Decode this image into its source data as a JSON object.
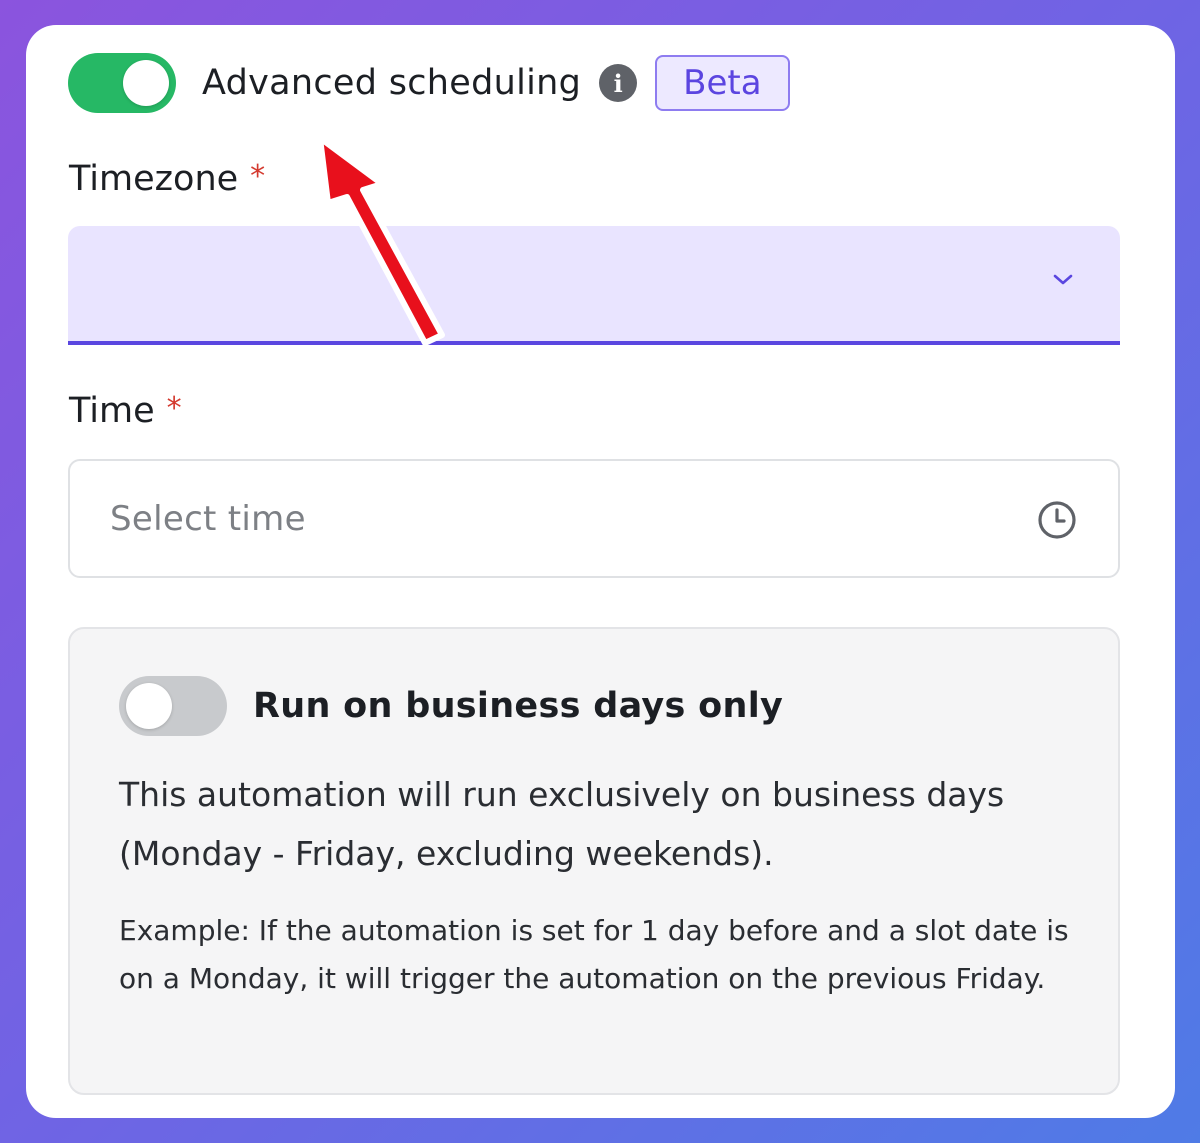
{
  "advanced_scheduling": {
    "enabled": true,
    "label": "Advanced scheduling",
    "info_icon": "i",
    "badge": "Beta"
  },
  "timezone": {
    "label": "Timezone",
    "required_mark": "*",
    "value": ""
  },
  "time": {
    "label": "Time",
    "required_mark": "*",
    "placeholder": "Select time"
  },
  "business_days": {
    "enabled": false,
    "label": "Run on business days only",
    "description": "This automation will run exclusively on business days (Monday - Friday, excluding weekends).",
    "example": "Example: If the automation is set for 1 day before and a slot date is on a Monday, it will trigger the automation on the previous Friday."
  },
  "colors": {
    "toggle_on": "#26b865",
    "toggle_off": "#c8cacd",
    "accent": "#5a46e0",
    "required": "#d43a2f",
    "arrow": "#e8101c"
  }
}
